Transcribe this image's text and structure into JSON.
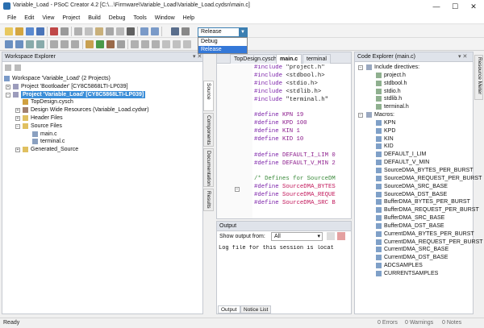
{
  "window": {
    "title": "Variable_Load - PSoC Creator 4.2  [C:\\...\\Firmware\\Variable_Load\\Variable_Load.cydsn\\main.c]",
    "minimize": "—",
    "maximize": "☐",
    "close": "✕"
  },
  "menu": [
    "File",
    "Edit",
    "View",
    "Project",
    "Build",
    "Debug",
    "Tools",
    "Window",
    "Help"
  ],
  "toolbar": {
    "config_selected": "Release",
    "config_options": [
      "Debug",
      "Release"
    ]
  },
  "workspace": {
    "title": "Workspace Explorer",
    "workspace_label": "Workspace 'Variable_Load' (2 Projects)",
    "projects": [
      "Project 'Bootloader' [CY8C5868LTI-LP039]",
      "Project 'Variable_Load' [CY8C5868LTI-LP039]"
    ],
    "items": [
      "TopDesign.cysch",
      "Design Wide Resources (Variable_Load.cydwr)",
      "Header Files",
      "Source Files",
      "main.c",
      "terminal.c",
      "Generated_Source"
    ],
    "vtabs": [
      "Source",
      "Components",
      "Documentation",
      "Results"
    ]
  },
  "editor": {
    "tabs": [
      "TopDesign.cysch",
      "main.c",
      "terminal"
    ],
    "lines": [
      {
        "k": "#include",
        "r": " \"project.h\""
      },
      {
        "k": "#include",
        "r": " <stdbool.h>"
      },
      {
        "k": "#include",
        "r": " <stdio.h>"
      },
      {
        "k": "#include",
        "r": " <stdlib.h>"
      },
      {
        "k": "#include",
        "r": " \"terminal.h\""
      },
      {
        "k": "",
        "r": ""
      },
      {
        "k": "#define",
        "r": " KPN 19"
      },
      {
        "k": "#define",
        "r": " KPD 100"
      },
      {
        "k": "#define",
        "r": " KIN 1"
      },
      {
        "k": "#define",
        "r": " KID 10"
      },
      {
        "k": "",
        "r": ""
      },
      {
        "k": "#define",
        "r": " DEFAULT_I_LIM 0"
      },
      {
        "k": "#define",
        "r": " DEFAULT_V_MIN 2"
      },
      {
        "k": "",
        "r": ""
      },
      {
        "k": "/* Defines for SourceDM",
        "r": ""
      },
      {
        "k": "#define",
        "r": " SourceDMA_BYTES"
      },
      {
        "k": "#define",
        "r": " SourceDMA_REQUE"
      },
      {
        "k": "#define",
        "r": " SourceDMA_SRC B"
      }
    ]
  },
  "output": {
    "title": "Output",
    "show_label": "Show output from:",
    "show_value": "All",
    "text": "Log file for this session is locat",
    "tabs": [
      "Output",
      "Notice List"
    ]
  },
  "code_explorer": {
    "title": "Code Explorer (main.c)",
    "include_header": "Include directives:",
    "includes": [
      "project.h",
      "stdbool.h",
      "stdio.h",
      "stdlib.h",
      "terminal.h"
    ],
    "macros_header": "Macros:",
    "macros": [
      "KPN",
      "KPD",
      "KIN",
      "KID",
      "DEFAULT_I_LIM",
      "DEFAULT_V_MIN",
      "SourceDMA_BYTES_PER_BURST",
      "SourceDMA_REQUEST_PER_BURST",
      "SourceDMA_SRC_BASE",
      "SourceDMA_DST_BASE",
      "BufferDMA_BYTES_PER_BURST",
      "BufferDMA_REQUEST_PER_BURST",
      "BufferDMA_SRC_BASE",
      "BufferDMA_DST_BASE",
      "CurrentDMA_BYTES_PER_BURST",
      "CurrentDMA_REQUEST_PER_BURST",
      "CurrentDMA_SRC_BASE",
      "CurrentDMA_DST_BASE",
      "ADCSAMPLES",
      "CURRENTSAMPLES"
    ],
    "side_tab": "Resource Meter"
  },
  "status": {
    "ready": "Ready",
    "errors": "0 Errors",
    "warnings": "0 Warnings",
    "notes": "0 Notes"
  },
  "colors": {
    "selection": "#3b8ed8",
    "accent": "#3c7fb1",
    "keyword": "#7a1fa8",
    "comment": "#3a8a3a"
  }
}
